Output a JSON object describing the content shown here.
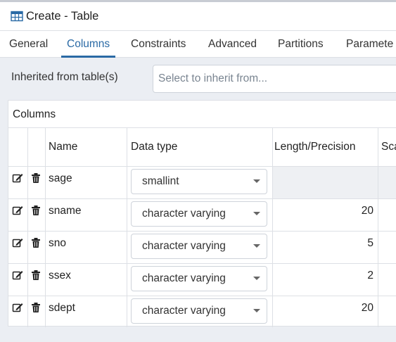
{
  "window": {
    "title": "Create - Table",
    "icon": "table-icon"
  },
  "tabs": [
    {
      "label": "General",
      "active": false
    },
    {
      "label": "Columns",
      "active": true
    },
    {
      "label": "Constraints",
      "active": false
    },
    {
      "label": "Advanced",
      "active": false
    },
    {
      "label": "Partitions",
      "active": false
    },
    {
      "label": "Paramete",
      "active": false
    }
  ],
  "inherit": {
    "label": "Inherited from table(s)",
    "placeholder": "Select to inherit from..."
  },
  "columns_panel": {
    "title": "Columns",
    "headers": {
      "name": "Name",
      "data_type": "Data type",
      "length_precision": "Length/Precision",
      "scale": "Sca"
    },
    "rows": [
      {
        "name": "sage",
        "data_type": "smallint",
        "length": ""
      },
      {
        "name": "sname",
        "data_type": "character varying",
        "length": "20"
      },
      {
        "name": "sno",
        "data_type": "character varying",
        "length": "5"
      },
      {
        "name": "ssex",
        "data_type": "character varying",
        "length": "2"
      },
      {
        "name": "sdept",
        "data_type": "character varying",
        "length": "20"
      }
    ]
  },
  "colors": {
    "accent": "#2a6aa5",
    "background": "#ebeef3",
    "border": "#dde0e5"
  }
}
